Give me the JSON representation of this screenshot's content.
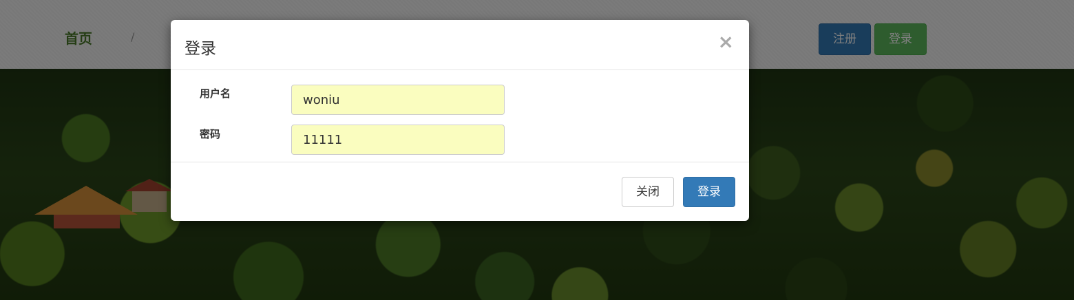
{
  "navbar": {
    "home_label": "首页",
    "separator": "/",
    "register_label": "注册",
    "login_label": "登录"
  },
  "modal": {
    "title": "登录",
    "close_icon": "×",
    "username_label": "用户名",
    "username_value": "woniu",
    "password_label": "密码",
    "password_value": "11111",
    "close_button_label": "关闭",
    "login_button_label": "登录"
  },
  "colors": {
    "primary": "#337ab7",
    "success": "#5cb85c",
    "autofill": "#fafdbf"
  }
}
